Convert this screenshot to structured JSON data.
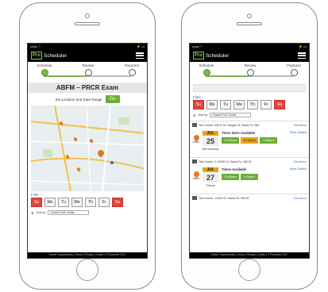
{
  "app": {
    "logo_box": "Pro",
    "logo_text": "Scheduler",
    "status_left": "•••oo ⌔",
    "status_right": "⚡ ▭"
  },
  "steps": [
    "Schedule",
    "Review",
    "Payment"
  ],
  "left": {
    "exam_title": "ABFM – PRCR Exam",
    "location_label": "Set Location and Date Range",
    "go_label": "Go",
    "filter_label": "Filter –",
    "days": [
      "Su",
      "Mo",
      "Tu",
      "We",
      "Th",
      "Fr",
      "Sa"
    ],
    "sort_label": "Sort by",
    "sort_value": "Closest Test Center",
    "footer": "Career Opportunities | Terms | Privacy | Cookie | © Prometric 2017"
  },
  "right": {
    "filter_label": "Filter –",
    "days": [
      "Su",
      "Mo",
      "Tu",
      "We",
      "Th",
      "Fr",
      "Sa"
    ],
    "sort_label": "Sort by",
    "sort_value": "Closest Test Center",
    "results": [
      {
        "center": "Test Centre, 550 E De Vargas St, Santa Fe, NM",
        "directions": "Directions",
        "miles": "Miles",
        "month": "JUL",
        "date": "25",
        "weekday": "Wednesday",
        "availability": "Three Slots Available",
        "more": "More Details",
        "slots": [
          "10:00am",
          "12:00pm",
          "2:00pm"
        ]
      },
      {
        "center": "Test Centre, 3 10000 St, Santa Fe, NM 87",
        "directions": "Directions",
        "miles": "Miles",
        "month": "JUL",
        "date": "27",
        "weekday": "Friday",
        "availability": "Times Available",
        "more": "More Details",
        "slots": [
          "11:00am",
          "4:00pm"
        ]
      },
      {
        "center": "Test Centre, 14000 St, Santa Fe, NM 87",
        "directions": "Directions"
      }
    ],
    "footer": "Career Opportunities | Terms | Privacy | Cookie | © Prometric 2017"
  },
  "colors": {
    "brand_green": "#6aae3a",
    "accent_orange": "#e8a317",
    "weekend_red": "#e3443e",
    "link_blue": "#2f6fb5"
  }
}
